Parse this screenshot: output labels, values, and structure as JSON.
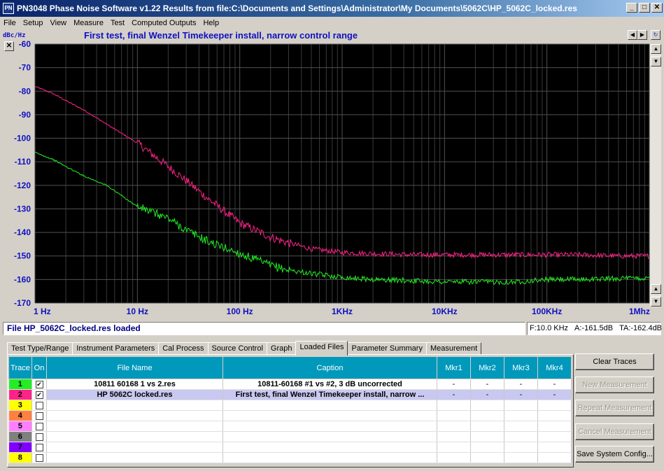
{
  "window": {
    "title": "PN3048 Phase Noise Software v1.22    Results from file:C:\\Documents and Settings\\Administrator\\My Documents\\5062C\\HP_5062C_locked.res",
    "icon_text": "PN",
    "minimize_glyph": "_",
    "maximize_glyph": "□",
    "close_glyph": "✕"
  },
  "menu": [
    "File",
    "Setup",
    "View",
    "Measure",
    "Test",
    "Computed Outputs",
    "Help"
  ],
  "graph": {
    "units_label": "dBc/Hz",
    "caption": "First test, final Wenzel Timekeeper install, narrow control range",
    "close_glyph": "✕",
    "scroll_left_glyph": "◀",
    "scroll_right_glyph": "▶",
    "refresh_glyph": "↻",
    "scroll_up_glyph": "▲",
    "scroll_down_glyph": "▼",
    "background_color": "#000000",
    "grid_color": "#505050"
  },
  "chart_data": {
    "type": "line",
    "title": "First test, final Wenzel Timekeeper install, narrow control range",
    "ylabel": "dBc/Hz",
    "xlabel": "",
    "x_scale": "log",
    "xlim": [
      1,
      1000000
    ],
    "ylim": [
      -170,
      -60
    ],
    "x_tick_values": [
      1,
      10,
      100,
      1000,
      10000,
      100000,
      1000000
    ],
    "x_tick_labels": [
      "1 Hz",
      "10 Hz",
      "100 Hz",
      "1KHz",
      "10KHz",
      "100KHz",
      "1Mhz"
    ],
    "y_tick_labels": [
      "-60",
      "-70",
      "-80",
      "-90",
      "-100",
      "-110",
      "-120",
      "-130",
      "-140",
      "-150",
      "-160",
      "-170"
    ],
    "y_tick_values": [
      -60,
      -70,
      -80,
      -90,
      -100,
      -110,
      -120,
      -130,
      -140,
      -150,
      -160,
      -170
    ],
    "grid": true,
    "series": [
      {
        "color": "#ff2288",
        "x": [
          1,
          1.5,
          2,
          3,
          5,
          10,
          20,
          30,
          50,
          100,
          200,
          300,
          500,
          1000,
          2000,
          5000,
          10000,
          20000,
          50000,
          100000,
          200000,
          500000,
          1000000
        ],
        "y": [
          -78,
          -81,
          -84,
          -88,
          -94,
          -102,
          -112,
          -118,
          -126,
          -136,
          -142,
          -144.5,
          -147,
          -148.5,
          -149,
          -149.5,
          -149.5,
          -149.5,
          -149.5,
          -149.5,
          -149.5,
          -150,
          -150
        ]
      },
      {
        "color": "#22ee22",
        "x": [
          1,
          1.5,
          2,
          3,
          5,
          10,
          20,
          30,
          50,
          100,
          200,
          300,
          500,
          1000,
          2000,
          5000,
          10000,
          20000,
          50000,
          100000,
          200000,
          500000,
          1000000
        ],
        "y": [
          -106,
          -109,
          -112,
          -116,
          -120,
          -129,
          -134,
          -139,
          -144,
          -149,
          -154,
          -156,
          -157.5,
          -159,
          -160,
          -160.5,
          -161,
          -161,
          -161,
          -160,
          -160,
          -159.5,
          -159.5
        ]
      }
    ]
  },
  "status": {
    "main": "File  HP_5062C_locked.res loaded",
    "freq": "F:10.0 KHz",
    "amp_a": "A:-161.5dB",
    "amp_ta": "TA:-162.4dB"
  },
  "tabs": [
    "Test Type/Range",
    "Instrument Parameters",
    "Cal Process",
    "Source Control",
    "Graph",
    "Loaded Files",
    "Parameter Summary",
    "Measurement"
  ],
  "table": {
    "headers": [
      "Trace",
      "On",
      "File Name",
      "Caption",
      "Mkr1",
      "Mkr2",
      "Mkr3",
      "Mkr4"
    ],
    "rows": [
      {
        "trace": "1",
        "color": "#22ee22",
        "on": "✔",
        "file": "10811  60168  1  vs  2.res",
        "caption": "10811-60168 #1 vs #2, 3 dB uncorrected",
        "m1": "-",
        "m2": "-",
        "m3": "-",
        "m4": "-"
      },
      {
        "trace": "2",
        "color": "#ff2288",
        "on": "✔",
        "file": "HP  5062C  locked.res",
        "caption": "First test, final Wenzel Timekeeper install, narrow ...",
        "m1": "-",
        "m2": "-",
        "m3": "-",
        "m4": "-"
      },
      {
        "trace": "3",
        "color": "#ffff00",
        "on": "",
        "file": "",
        "caption": "",
        "m1": "",
        "m2": "",
        "m3": "",
        "m4": ""
      },
      {
        "trace": "4",
        "color": "#ff8040",
        "on": "",
        "file": "",
        "caption": "",
        "m1": "",
        "m2": "",
        "m3": "",
        "m4": ""
      },
      {
        "trace": "5",
        "color": "#ff80ff",
        "on": "",
        "file": "",
        "caption": "",
        "m1": "",
        "m2": "",
        "m3": "",
        "m4": ""
      },
      {
        "trace": "6",
        "color": "#808080",
        "on": "",
        "file": "",
        "caption": "",
        "m1": "",
        "m2": "",
        "m3": "",
        "m4": ""
      },
      {
        "trace": "7",
        "color": "#8000ff",
        "on": "",
        "file": "",
        "caption": "",
        "m1": "",
        "m2": "",
        "m3": "",
        "m4": ""
      },
      {
        "trace": "8",
        "color": "#ffff00",
        "on": "",
        "file": "",
        "caption": "",
        "m1": "",
        "m2": "",
        "m3": "",
        "m4": ""
      }
    ]
  },
  "buttons": {
    "clear_traces": "Clear Traces",
    "new_measurement": "New Measurement",
    "repeat_measurement": "Repeat Measurement",
    "cancel_measurement": "Cancel Measurement",
    "save_system_config": "Save System Config..."
  }
}
